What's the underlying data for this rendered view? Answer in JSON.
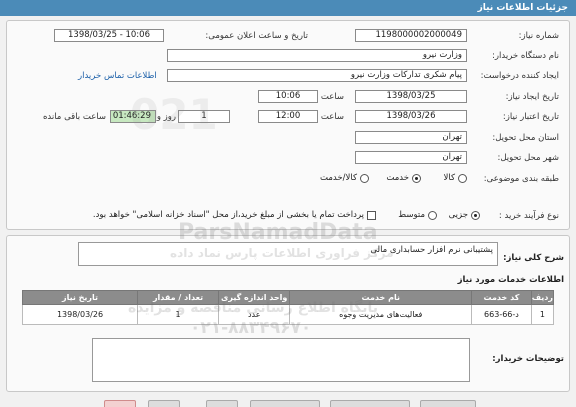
{
  "header": {
    "title": "جزئیات اطلاعات نیاز"
  },
  "form": {
    "need_number_label": "شماره نیاز:",
    "need_number": "1198000002000049",
    "announce_label": "تاریخ و ساعت اعلان عمومی:",
    "announce_value": "1398/03/25 - 10:06",
    "buyer_label": "نام دستگاه خریدار:",
    "buyer": "وزارت نیرو",
    "creator_label": "ایجاد کننده درخواست:",
    "creator": "پیام شکری تدارکات وزارت نیرو",
    "contact_link": "اطلاعات تماس خریدار",
    "created_date_label": "تاریخ ایجاد نیاز:",
    "created_date": "1398/03/25",
    "time_label": "ساعت",
    "created_time": "10:06",
    "validity_label": "تاریخ اعتبار نیاز:",
    "validity_date": "1398/03/26",
    "validity_time": "12:00",
    "days_value": "1",
    "days_label": "روز و",
    "remaining_time": "01:46:29",
    "remaining_label": "ساعت باقی مانده",
    "province_label": "استان محل تحویل:",
    "province": "تهران",
    "city_label": "شهر محل تحویل:",
    "city": "تهران",
    "category_label": "طبقه بندی موضوعی:",
    "category_options": [
      "کالا",
      "خدمت",
      "کالا/خدمت"
    ],
    "process_label": "نوع فرآیند خرید :",
    "process_options": [
      "جزیی",
      "متوسط"
    ],
    "payment_note": "پرداخت تمام یا بخشی از مبلغ خرید،از محل \"اسناد خزانه اسلامی\" خواهد بود."
  },
  "summary": {
    "label": "شرح کلی نیاز:",
    "value": "پشتیبانی نرم افزار حسابداری مالی"
  },
  "services": {
    "section_title": "اطلاعات خدمات مورد نیاز",
    "columns": [
      "ردیف",
      "کد خدمت",
      "نام خدمت",
      "واحد اندازه گیری",
      "تعداد / مقدار",
      "تاریخ نیاز"
    ],
    "rows": [
      [
        "1",
        "د-66-663",
        "فعالیت‌های مدیریت وجوه",
        "عدد",
        "1",
        "1398/03/26"
      ]
    ]
  },
  "buyer_notes": {
    "label": "توضیحات خریدار:",
    "value": ""
  },
  "watermark": {
    "line1": "ParsNamadData",
    "line2": "مرکز فراوری اطلاعات پارس نماد داده",
    "line3": "پایگاه اطلاع رسانی مناقصه و مزایده",
    "phone": "۰۲۱-۸۸۳۴۹۶۷۰"
  },
  "colors": {
    "titlebar": "#4b8bb8",
    "table_header": "#8c8c8c",
    "remaining_bg": "#c7e8c0",
    "link": "#1b5fa8"
  }
}
